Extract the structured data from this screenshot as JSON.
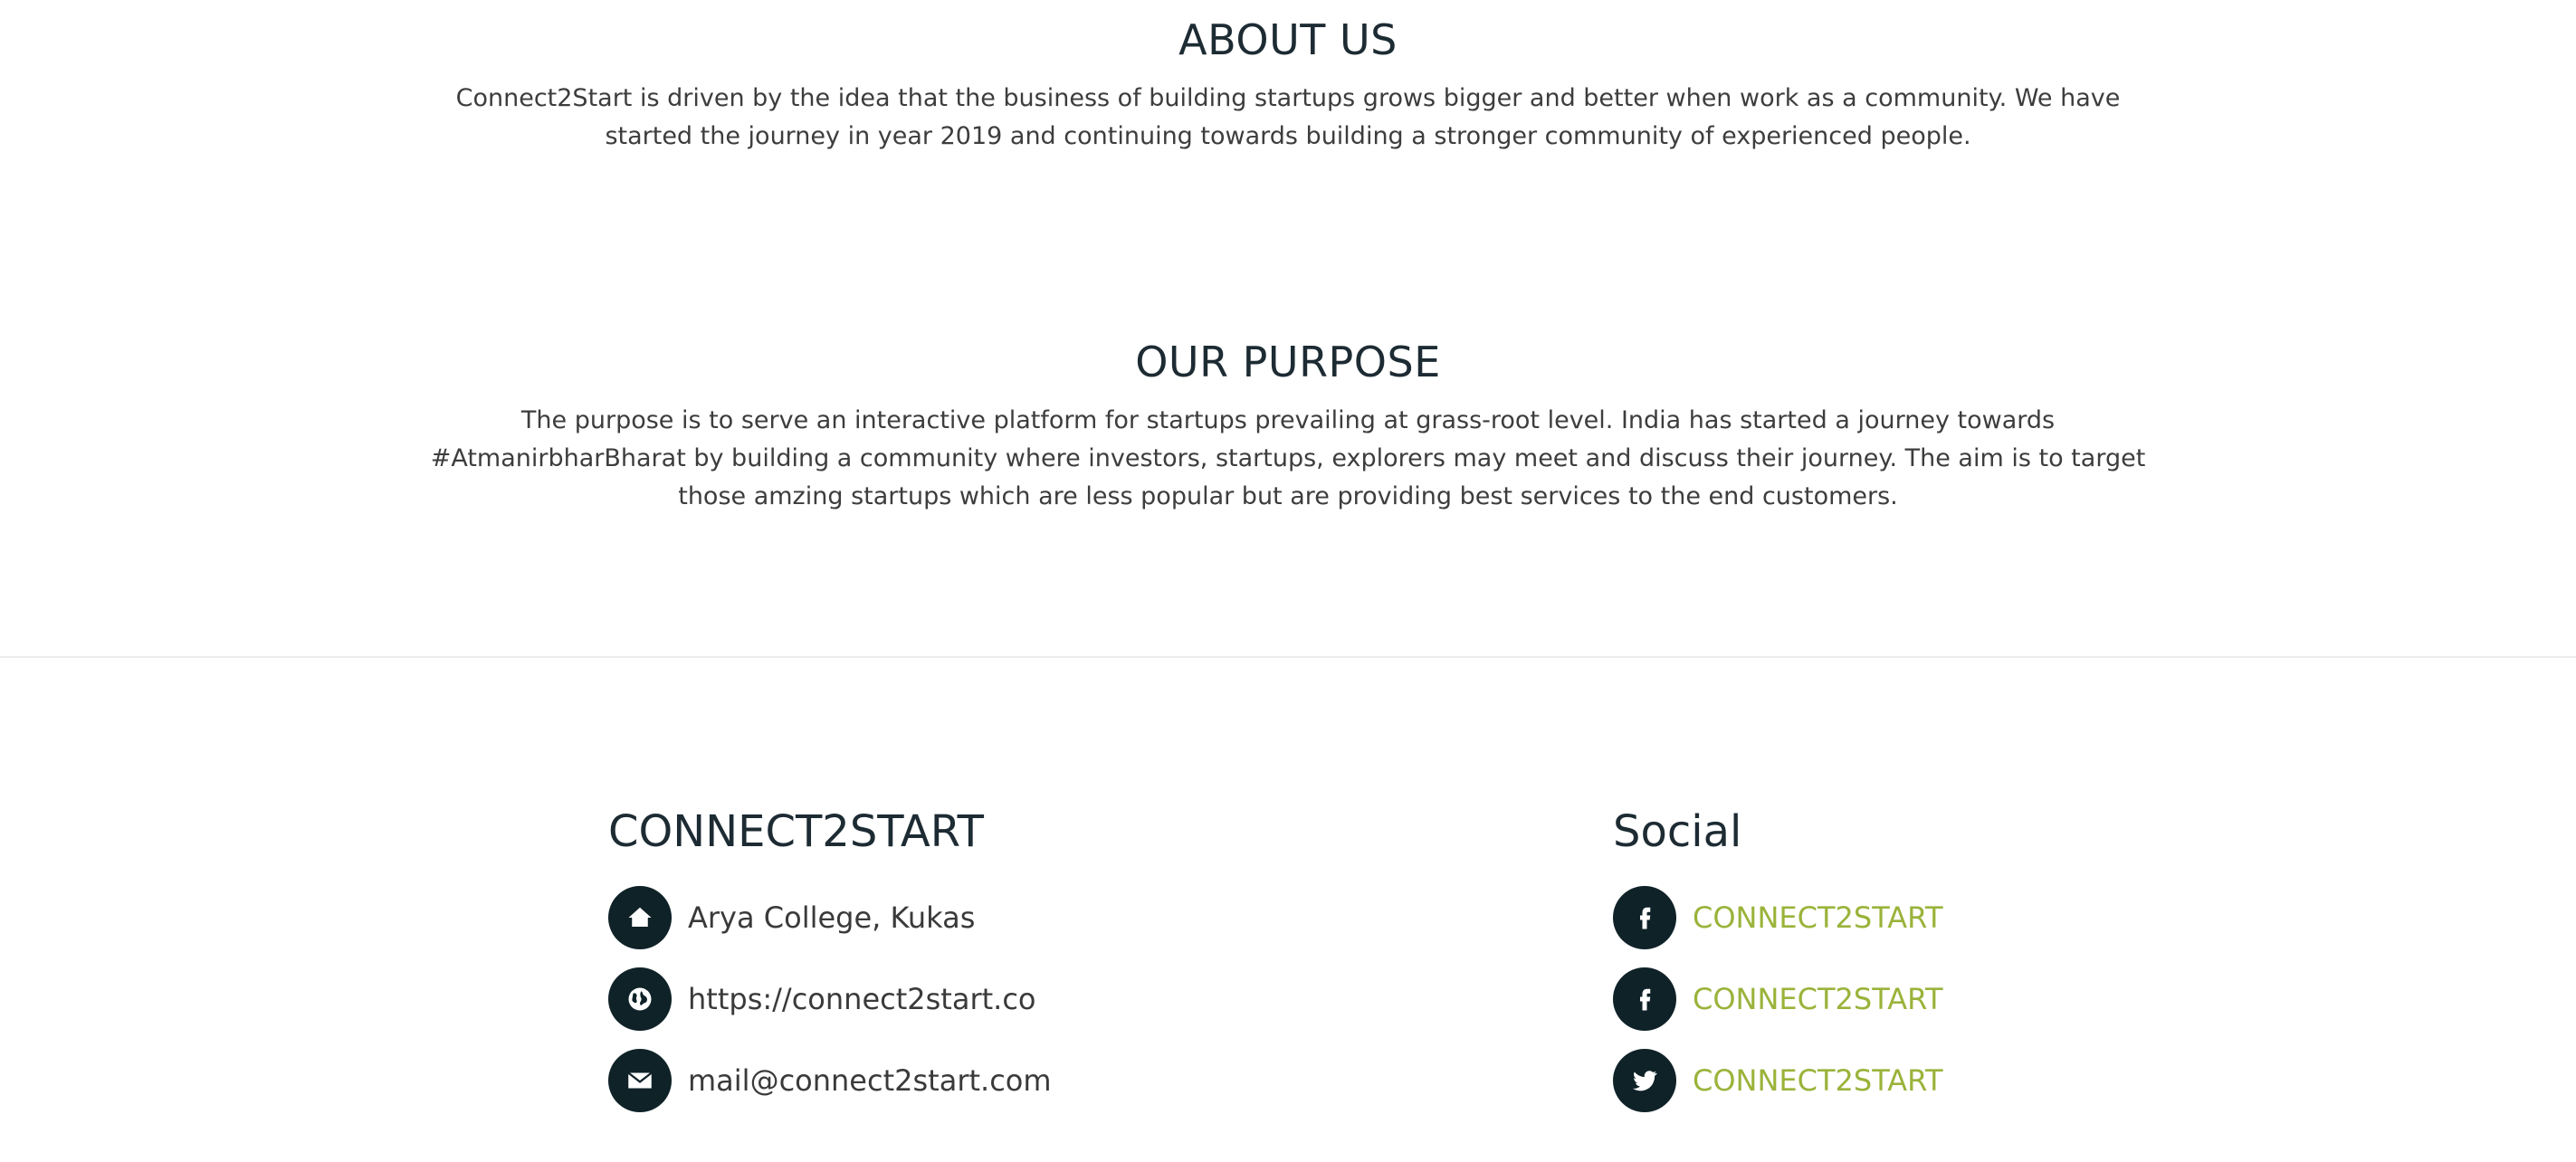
{
  "about": {
    "title": "ABOUT US",
    "text": "Connect2Start is driven by the idea that the business of building startups grows bigger and better when work as a community. We have started the journey in year 2019 and continuing towards building a stronger community of experienced people."
  },
  "purpose": {
    "title": "OUR PURPOSE",
    "text": "The purpose is to serve an interactive platform for startups prevailing at grass-root level. India has started a journey towards #AtmanirbharBharat by building a community where investors, startups, explorers may meet and discuss their journey. The aim is to target those amzing startups which are less popular but are providing best services to the end customers."
  },
  "footer": {
    "contact": {
      "title": "CONNECT2START",
      "address": "Arya College, Kukas",
      "website": "https://connect2start.co",
      "email": "mail@connect2start.com",
      "icons": [
        "home-icon",
        "globe-icon",
        "mail-icon"
      ]
    },
    "social": {
      "title": "Social",
      "links": [
        {
          "icon": "facebook-icon",
          "label": "CONNECT2START"
        },
        {
          "icon": "facebook-icon",
          "label": "CONNECT2START"
        },
        {
          "icon": "twitter-icon",
          "label": "CONNECT2START"
        }
      ]
    }
  },
  "colors": {
    "heading": "#1d2b33",
    "body_text": "#3a3a3a",
    "icon_circle": "#0f2228",
    "link": "#9ab33a",
    "divider": "#ececec"
  }
}
